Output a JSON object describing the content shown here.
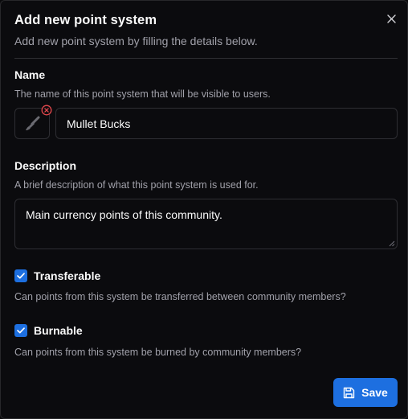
{
  "dialog": {
    "title": "Add new point system",
    "subtitle": "Add new point system by filling the details below.",
    "close_icon": "close-icon"
  },
  "name_field": {
    "label": "Name",
    "hint": "The name of this point system that will be visible to users.",
    "value": "Mullet Bucks",
    "icon": "paintbrush-icon"
  },
  "description_field": {
    "label": "Description",
    "hint": "A brief description of what this point system is used for.",
    "value": "Main currency points of this community."
  },
  "transferable": {
    "label": "Transferable",
    "checked": true,
    "hint": "Can points from this system be transferred between community members?"
  },
  "burnable": {
    "label": "Burnable",
    "checked": true,
    "hint": "Can points from this system be burned by community members?"
  },
  "actions": {
    "save_label": "Save",
    "save_icon": "save-icon"
  },
  "colors": {
    "accent": "#1d6fe0",
    "danger": "#e5484d",
    "background": "#0b0b0e",
    "muted_text": "#a1a1aa"
  }
}
